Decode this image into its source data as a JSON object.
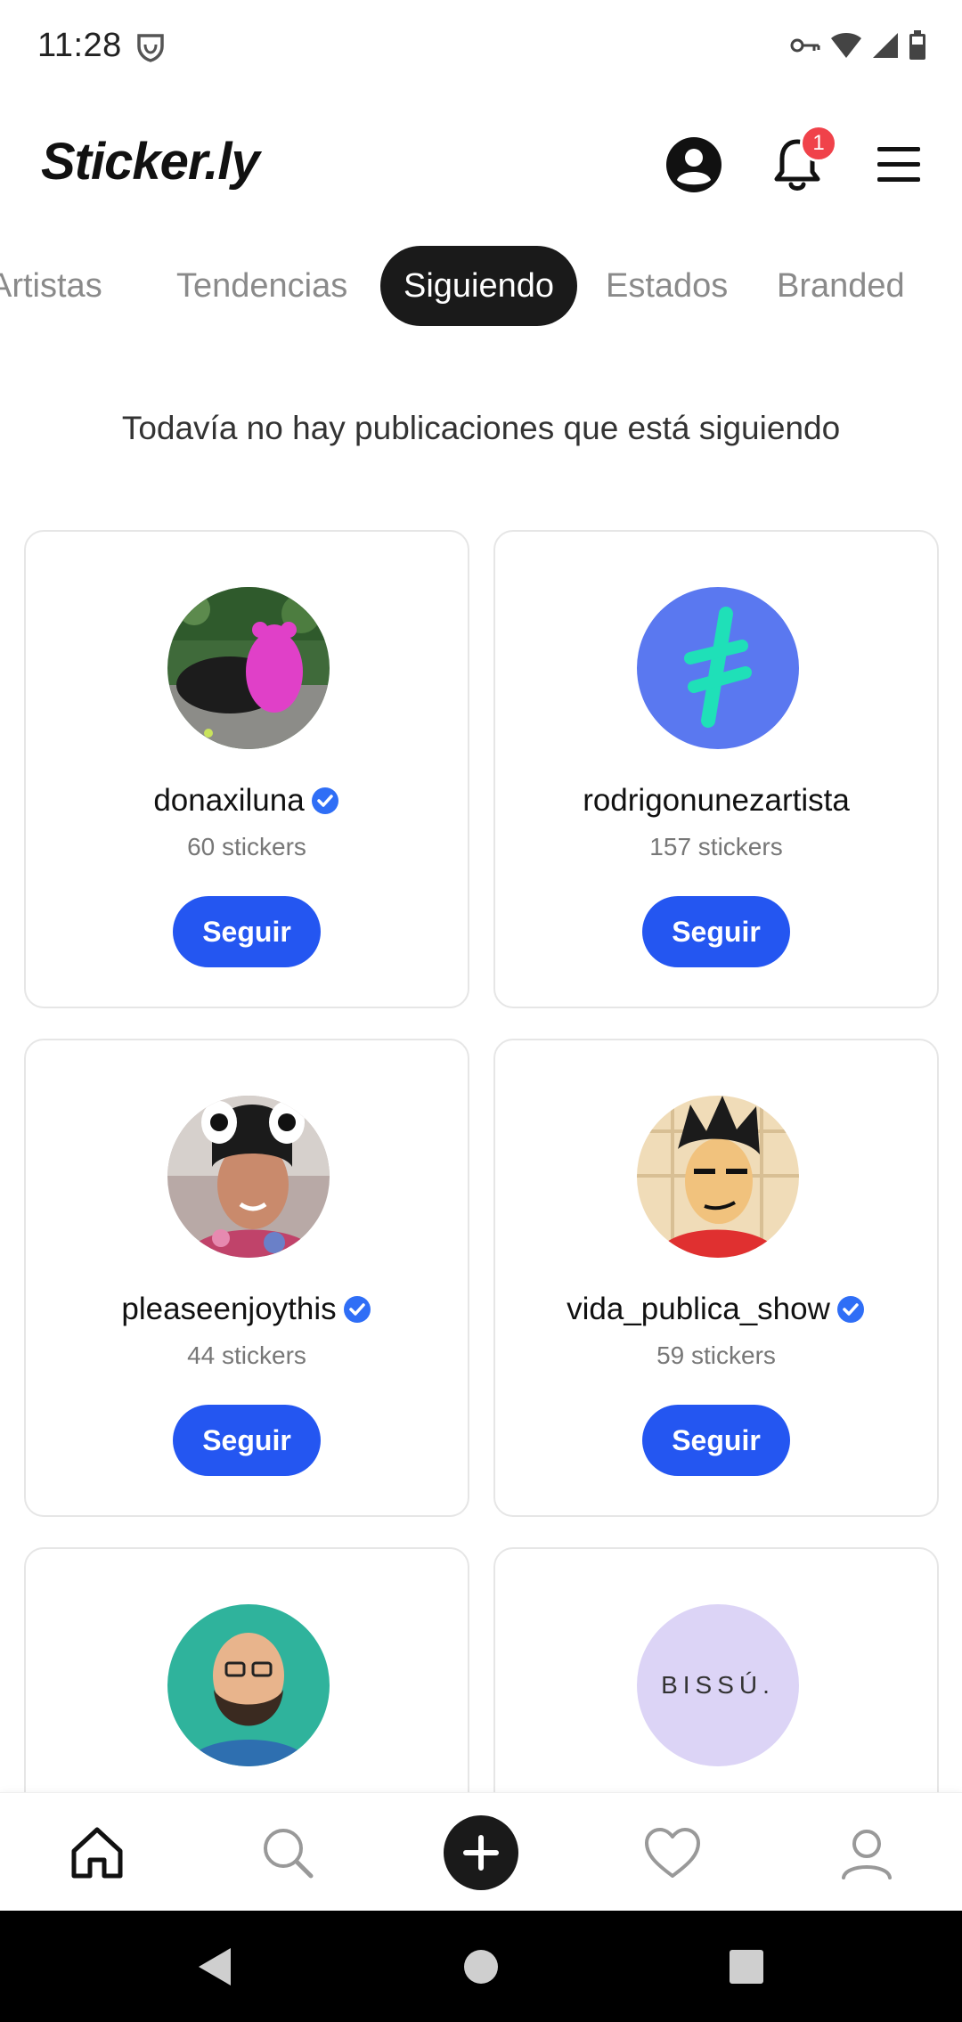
{
  "status_bar": {
    "time": "11:28"
  },
  "header": {
    "logo": "Sticker.ly",
    "notification_count": "1"
  },
  "tabs": [
    {
      "label": "Artistas"
    },
    {
      "label": "Tendencias"
    },
    {
      "label": "Siguiendo"
    },
    {
      "label": "Estados"
    },
    {
      "label": "Branded"
    }
  ],
  "empty_message": "Todavía no hay publicaciones que está siguiendo",
  "creators": [
    {
      "name": "donaxiluna",
      "count": "60 stickers",
      "verified": true,
      "follow": "Seguir"
    },
    {
      "name": "rodrigonunezartista",
      "count": "157 stickers",
      "verified": false,
      "follow": "Seguir"
    },
    {
      "name": "pleaseenjoythis",
      "count": "44 stickers",
      "verified": true,
      "follow": "Seguir"
    },
    {
      "name": "vida_publica_show",
      "count": "59 stickers",
      "verified": true,
      "follow": "Seguir"
    },
    {
      "name": "",
      "count": "",
      "verified": false,
      "follow": ""
    },
    {
      "name": "",
      "count": "",
      "verified": false,
      "follow": "",
      "avatar_text": "BISSÚ."
    }
  ],
  "colors": {
    "accent": "#2456f1",
    "badge": "#f0424a",
    "active_tab": "#1a1a1a"
  }
}
